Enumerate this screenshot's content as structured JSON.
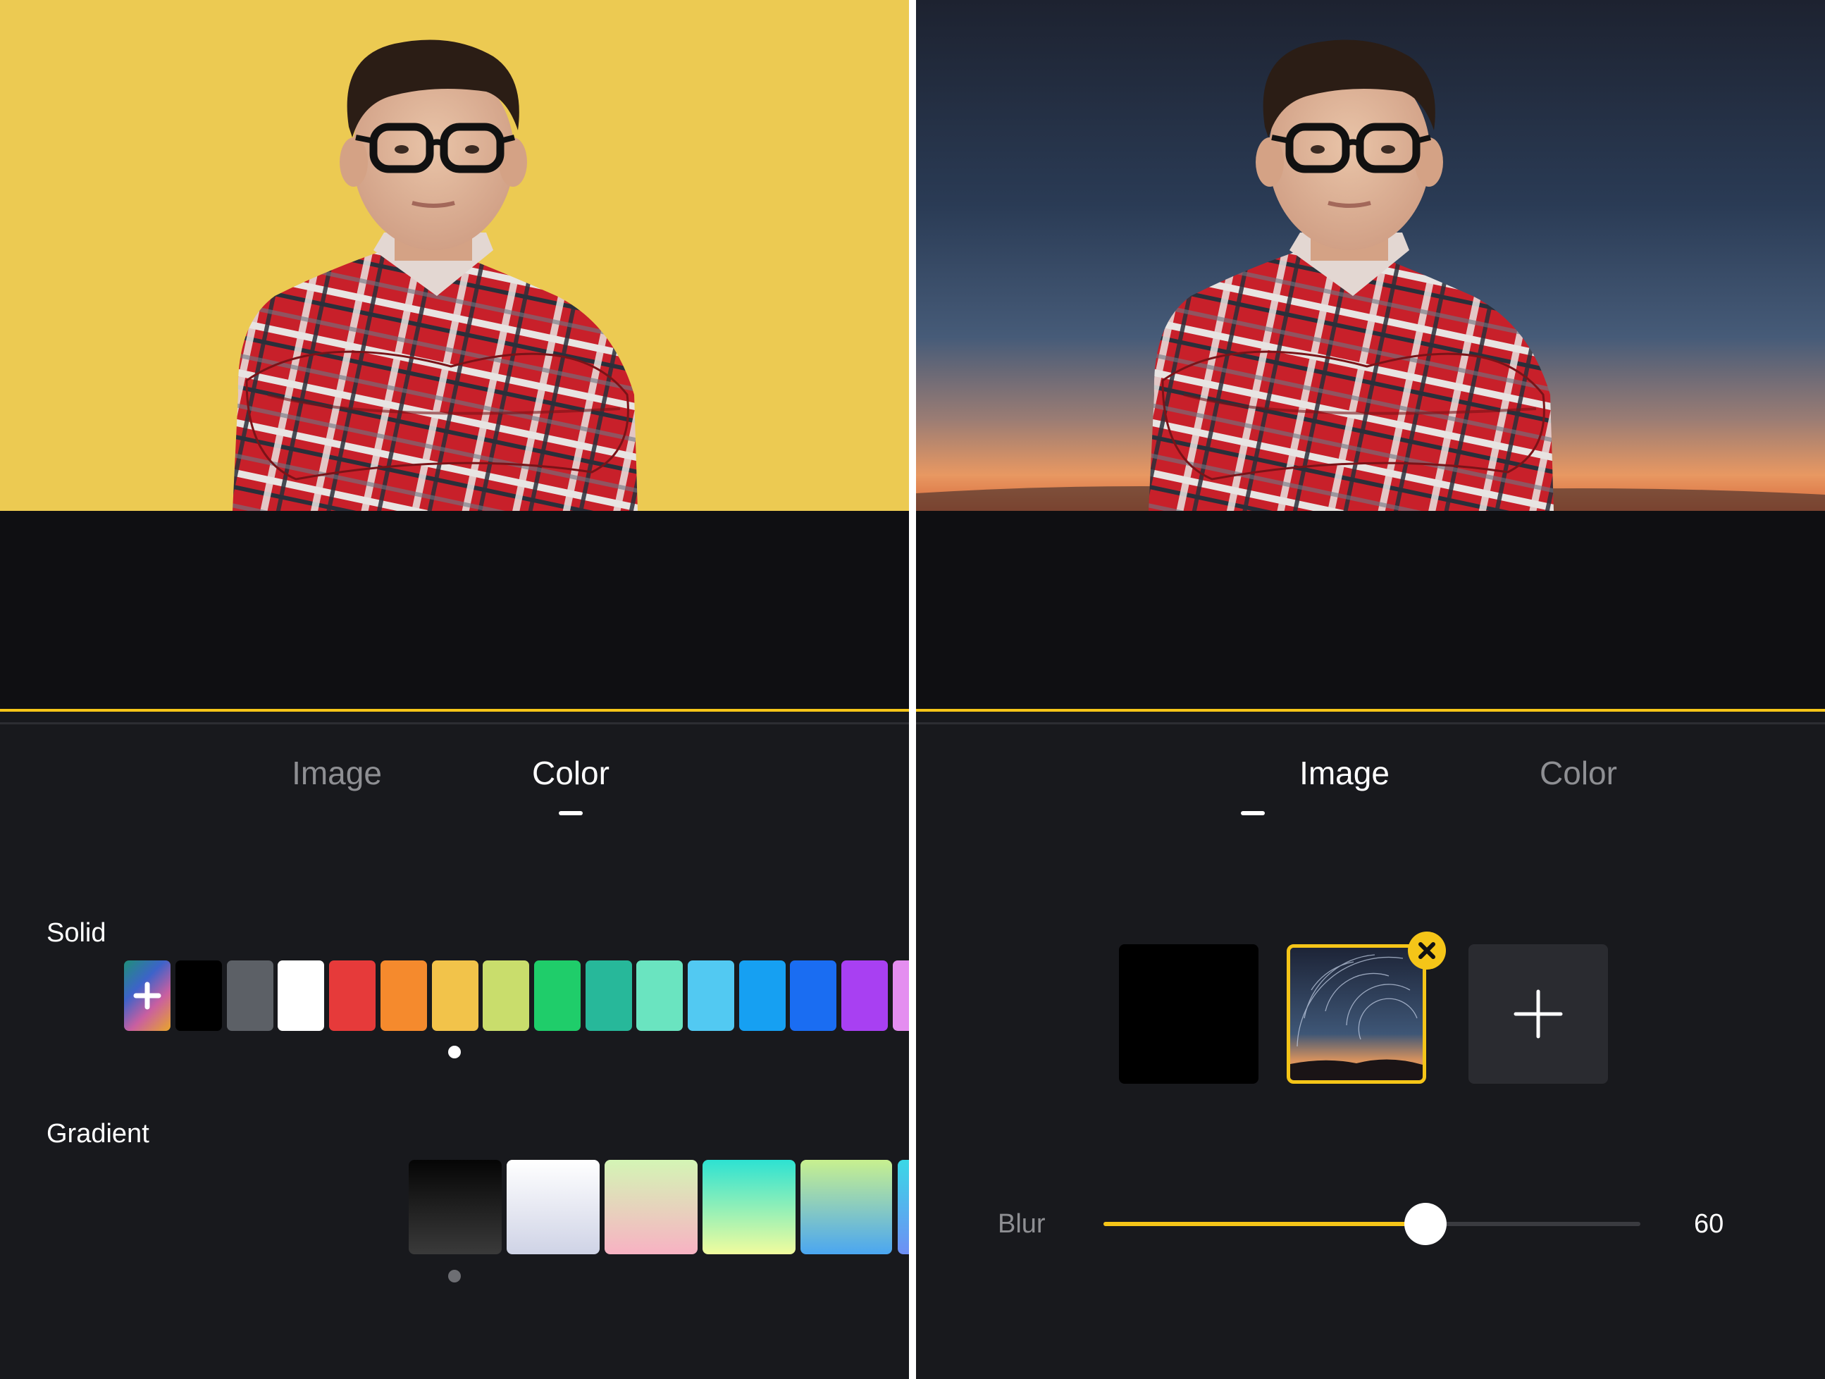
{
  "left_panel": {
    "tabs": [
      {
        "label": "Image",
        "active": false
      },
      {
        "label": "Color",
        "active": true
      }
    ],
    "solid": {
      "label": "Solid",
      "add_icon": "plus-icon",
      "colors": [
        "#000000",
        "#5c6066",
        "#ffffff",
        "#e63a3a",
        "#f58a2d",
        "#f2c34a",
        "#c9dd6c",
        "#1fcd6a",
        "#27b89a",
        "#6ae4c0",
        "#52c9f2",
        "#16a0f2",
        "#1a6df2",
        "#a840f2",
        "#e48ef0"
      ],
      "selected_index": 5
    },
    "gradient": {
      "label": "Gradient",
      "selected_index": 0
    }
  },
  "right_panel": {
    "tabs": [
      {
        "label": "Image",
        "active": true
      },
      {
        "label": "Color",
        "active": false
      }
    ],
    "thumbnails": [
      {
        "kind": "black"
      },
      {
        "kind": "star-trails",
        "selected": true,
        "remove_icon": "close-icon"
      },
      {
        "kind": "add",
        "icon": "plus-icon"
      }
    ],
    "blur": {
      "label": "Blur",
      "value": 60,
      "value_text": "60",
      "min": 0,
      "max": 100
    }
  },
  "colors": {
    "accent": "#f5c518",
    "panel_bg": "#18191d",
    "preview_bg_left": "#ecca52",
    "tab_inactive": "#8e8f93"
  }
}
